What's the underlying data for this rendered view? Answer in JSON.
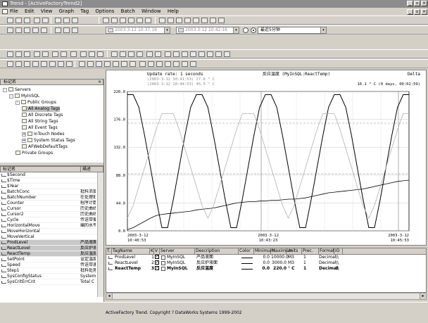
{
  "window": {
    "title": "Trend - [ActiveFactoryTrend2]"
  },
  "menu": [
    "File",
    "Edit",
    "View",
    "Graph",
    "Tag",
    "Options",
    "Batch",
    "Window",
    "Help"
  ],
  "toolbar2": {
    "start_time": "2003-3-12 10:37:16",
    "end_time": "2003-3-12 10:42:16",
    "duration": "最近5分钟"
  },
  "tree": {
    "title": "标记名",
    "items": [
      {
        "label": "Servers",
        "level": 0,
        "expander": "-"
      },
      {
        "label": "MyInSQL",
        "level": 1,
        "expander": "-"
      },
      {
        "label": "Public Groups",
        "level": 2,
        "expander": "-"
      },
      {
        "label": "All Analog Tags",
        "level": 3,
        "expander": "",
        "selected": true
      },
      {
        "label": "All Discrete Tags",
        "level": 3,
        "expander": ""
      },
      {
        "label": "All String Tags",
        "level": 3,
        "expander": ""
      },
      {
        "label": "All Event Tags",
        "level": 3,
        "expander": ""
      },
      {
        "label": "InTouch Nodes",
        "level": 3,
        "expander": "+"
      },
      {
        "label": "System Status Tags",
        "level": 3,
        "expander": "+"
      },
      {
        "label": "AFWebDefaultTags",
        "level": 3,
        "expander": ""
      },
      {
        "label": "Private Groups",
        "level": 2,
        "expander": ""
      }
    ]
  },
  "taglist": {
    "col_name": "标记名",
    "col_desc": "描述",
    "rows": [
      {
        "name": "$Second",
        "desc": ""
      },
      {
        "name": "$Time",
        "desc": ""
      },
      {
        "name": "$Year",
        "desc": ""
      },
      {
        "name": "BatchConc",
        "desc": "批料浓度"
      },
      {
        "name": "BatchNumber",
        "desc": "在处理批"
      },
      {
        "name": "Counter",
        "desc": "程序计数"
      },
      {
        "name": "Cursor",
        "desc": "历史曲线"
      },
      {
        "name": "Cursor2",
        "desc": "历史曲线"
      },
      {
        "name": "Cycle",
        "desc": "传送带循"
      },
      {
        "name": "HorizontalMove",
        "desc": "编的水平"
      },
      {
        "name": "MoveHorizontal",
        "desc": ""
      },
      {
        "name": "MoveVertical",
        "desc": ""
      },
      {
        "name": "ProdLevel",
        "desc": "产品液面",
        "selected": true
      },
      {
        "name": "ReactLevel",
        "desc": "反应炉液",
        "selected": true
      },
      {
        "name": "ReactTemp",
        "desc": "反应温度",
        "selected": true
      },
      {
        "name": "SetPoint",
        "desc": "设定温度"
      },
      {
        "name": "Speed",
        "desc": "传送带速"
      },
      {
        "name": "Step1",
        "desc": "批料处理"
      },
      {
        "name": "SysConfigStatus",
        "desc": "System"
      },
      {
        "name": "SysCritErrCnt",
        "desc": "Total C"
      }
    ]
  },
  "chart": {
    "update_rate": "Update rate: 1 seconds",
    "cursor1": "(2003-3-12 10:41:53)  27.6 ° C",
    "cursor2": "(2003-3-12 10:44:53)  45.5 ° C",
    "center_title": "反应温度 (MyInSQL:ReactTemp)",
    "delta": "Delta",
    "delta_value": "16.1 ° C (0 days, 00:02:59)"
  },
  "chart_data": {
    "type": "line",
    "x_tick_labels": [
      "2003-3-12\n10:40:53",
      "2003-3-12\n10:43:23",
      "2003-3-12\n10:45:53"
    ],
    "y_tick_labels": [
      "0.0",
      "44.0",
      "88.0",
      "132.0",
      "176.0",
      "220.0"
    ],
    "ylim": [
      0,
      220
    ],
    "grid": true,
    "series": [
      {
        "name": "ReactTemp",
        "color": "#000000",
        "values": [
          215,
          215,
          195,
          150,
          100,
          50,
          5,
          5,
          50,
          100,
          150,
          195,
          215,
          215,
          195,
          150,
          100,
          50,
          5,
          5,
          50,
          100,
          150,
          195,
          215,
          215,
          195,
          150,
          100,
          50,
          5,
          5,
          50,
          100,
          150,
          195,
          215,
          215,
          195,
          150,
          100,
          50,
          5,
          5,
          50,
          100,
          150,
          195,
          215,
          215
        ]
      },
      {
        "name": "ReactLevel",
        "color": "#000000",
        "values": [
          2,
          5,
          10,
          15,
          20,
          24,
          26,
          27,
          28,
          29,
          30,
          31,
          33,
          34,
          35,
          36,
          38,
          40,
          42,
          44,
          45,
          46,
          46,
          47,
          47,
          48,
          48,
          49,
          50,
          50,
          51,
          52,
          54,
          56,
          58,
          60,
          61,
          62,
          63,
          64,
          65,
          66,
          68,
          70,
          72,
          74,
          76,
          78,
          79,
          80
        ]
      },
      {
        "name": "ProdLevel",
        "color": "#b0b0b0",
        "values": [
          20,
          40,
          70,
          100,
          130,
          160,
          185,
          185,
          185,
          160,
          130,
          100,
          70,
          40,
          20,
          40,
          70,
          100,
          130,
          160,
          185,
          185,
          185,
          160,
          130,
          100,
          70,
          40,
          20,
          40,
          70,
          100,
          130,
          160,
          185,
          185,
          185,
          160,
          130,
          100,
          70,
          40,
          20,
          40,
          70,
          100,
          130,
          160,
          185,
          185
        ]
      }
    ]
  },
  "grid": {
    "headers": [
      "T.",
      "TagName",
      "K",
      "V",
      "Server",
      "Description",
      "Color",
      "Minimum",
      "Maximum",
      "Units",
      "Prec.",
      "Format",
      "IO"
    ],
    "rows": [
      {
        "tag": "ProdLevel",
        "k": "1",
        "server": "MyInSQL",
        "desc": "产品液面",
        "min": "0.0",
        "max": "10000.0",
        "units": "M3",
        "prec": "1",
        "format": "Decimal",
        "io": "\\\\",
        "bold": false
      },
      {
        "tag": "ReactLevel",
        "k": "2",
        "server": "MyInSQL",
        "desc": "反应炉液面",
        "min": "0.0",
        "max": "3000.0",
        "units": "M3",
        "prec": "1",
        "format": "Decimal",
        "io": "\\\\",
        "bold": false
      },
      {
        "tag": "ReactTemp",
        "k": "3",
        "server": "MyInSQL",
        "desc": "反应温度",
        "min": "0.0",
        "max": "220.0",
        "units": "° C",
        "prec": "1",
        "format": "Decimal",
        "io": "\\\\",
        "bold": true
      }
    ]
  },
  "status": {
    "text": "ActiveFactory Trend. Copyright ? DataWorks Systems 1999-2002"
  }
}
